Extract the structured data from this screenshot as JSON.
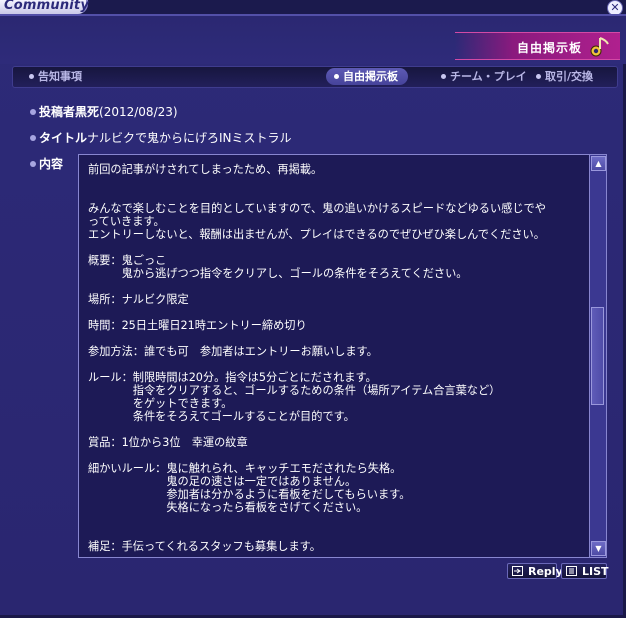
{
  "window": {
    "title": "Community"
  },
  "header": {
    "title": "自由掲示板"
  },
  "nav": {
    "items": [
      {
        "label": "告知事項"
      },
      {
        "label": "自由掲示板"
      },
      {
        "label": "チーム・プレイ"
      },
      {
        "label": "取引/交換"
      }
    ]
  },
  "post": {
    "author_label": "投稿者",
    "author": "黒死",
    "date": "(2012/08/23)",
    "title_label": "タイトル",
    "title": "ナルビクで鬼からにげろINミストラル",
    "content_label": "内容",
    "content_lines": [
      "前回の記事がけされてしまったため、再掲載。",
      "",
      "",
      "みんなで楽しむことを目的としていますので、鬼の追いかけるスピードなどゆるい感じでや",
      "っていきます。",
      "エントリーしないと、報酬は出ませんが、プレイはできるのでぜひぜひ楽しんでください。",
      "",
      "概要：鬼ごっこ",
      "　　　鬼から逃げつつ指令をクリアし、ゴールの条件をそろえてください。",
      "",
      "場所：ナルビク限定",
      "",
      "時間：25日土曜日21時エントリー締め切り",
      "",
      "参加方法：誰でも可　参加者はエントリーお願いします。",
      "",
      "ルール：制限時間は20分。指令は5分ごとにだされます。",
      "　　　　指令をクリアすると、ゴールするための条件（場所アイテム合言葉など）",
      "　　　　をゲットできます。",
      "　　　　条件をそろえてゴールすることが目的です。",
      "",
      "賞品：1位から3位　幸運の紋章",
      "",
      "細かいルール：鬼に触れられ、キャッチエモだされたら失格。",
      "　　　　　　　鬼の足の速さは一定ではありません。",
      "　　　　　　　参加者は分かるように看板をだしてもらいます。",
      "　　　　　　　失格になったら看板をさげてください。",
      "",
      "",
      "補足：手伝ってくれるスタッフも募集します。"
    ]
  },
  "buttons": {
    "reply": "Reply",
    "list": "LIST"
  },
  "icons": {
    "close": "close-icon",
    "note": "music-note-icon",
    "reply": "reply-icon",
    "list": "list-icon"
  },
  "colors": {
    "background": "#2a2670",
    "banner": "#b0208e",
    "panel": "#1d1a56",
    "text": "#ffffff"
  }
}
